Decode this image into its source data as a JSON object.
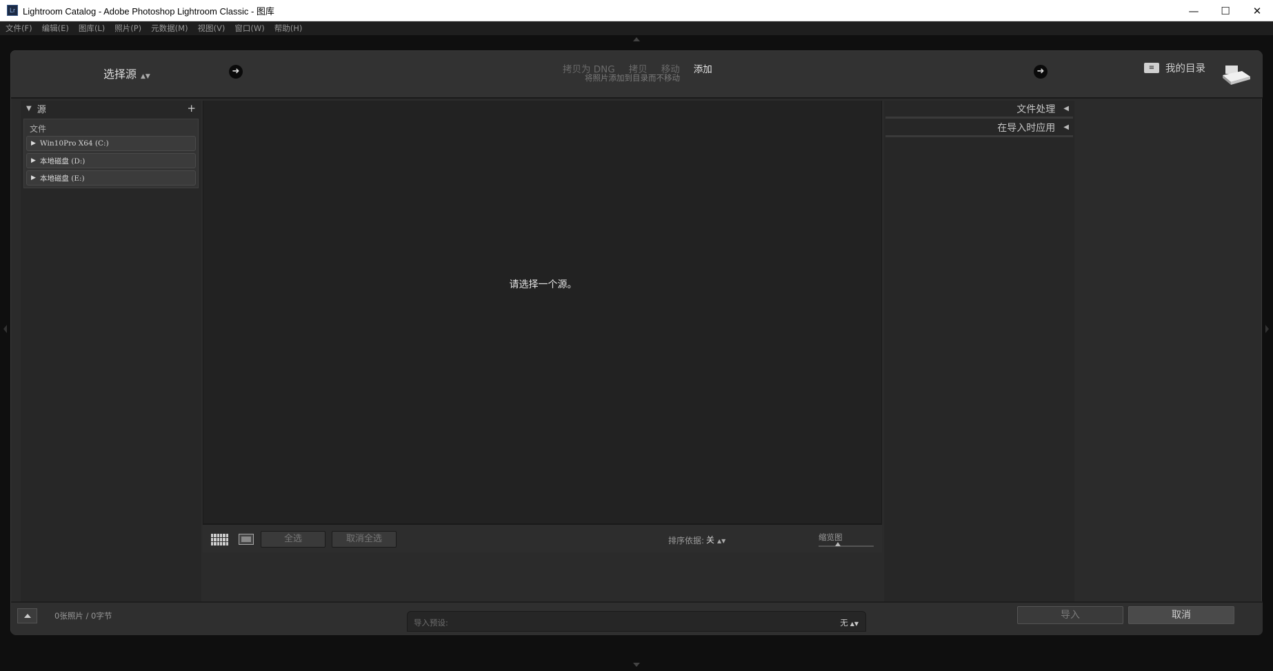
{
  "window": {
    "app_icon": "Lr",
    "title": "Lightroom Catalog - Adobe Photoshop Lightroom Classic - 图库",
    "controls": {
      "minimize": "—",
      "maximize": "☐",
      "close": "✕"
    }
  },
  "menu": [
    "文件(F)",
    "编辑(E)",
    "图库(L)",
    "照片(P)",
    "元数据(M)",
    "视图(V)",
    "窗口(W)",
    "帮助(H)"
  ],
  "header": {
    "source_select": "选择源",
    "modes": [
      "拷贝为 DNG",
      "拷贝",
      "移动",
      "添加"
    ],
    "active_mode": "添加",
    "mode_description": "将照片添加到目录而不移动",
    "catalog_label": "我的目录",
    "catalog_icon": "catalog-icon",
    "destination_icon": "hard-disk-icon"
  },
  "left_panel": {
    "title": "源",
    "add_button": "+",
    "files_title": "文件",
    "drives": [
      "Win10Pro X64 (C:)",
      "本地磁盘 (D:)",
      "本地磁盘 (E:)"
    ]
  },
  "center": {
    "message": "请选择一个源。",
    "toolbar": {
      "select_all": "全选",
      "deselect_all": "取消全选",
      "sort_label": "排序依据:",
      "sort_value": "关",
      "thumbnail_label": "缩览图",
      "thumbnail_level": 0.35
    }
  },
  "right_panel": {
    "sections": [
      "文件处理",
      "在导入时应用"
    ]
  },
  "bottom_bar": {
    "photo_count": "0张照片 / 0字节",
    "preset_label": "导入预设:",
    "preset_value": "无",
    "import_button": "导入",
    "cancel_button": "取消"
  }
}
